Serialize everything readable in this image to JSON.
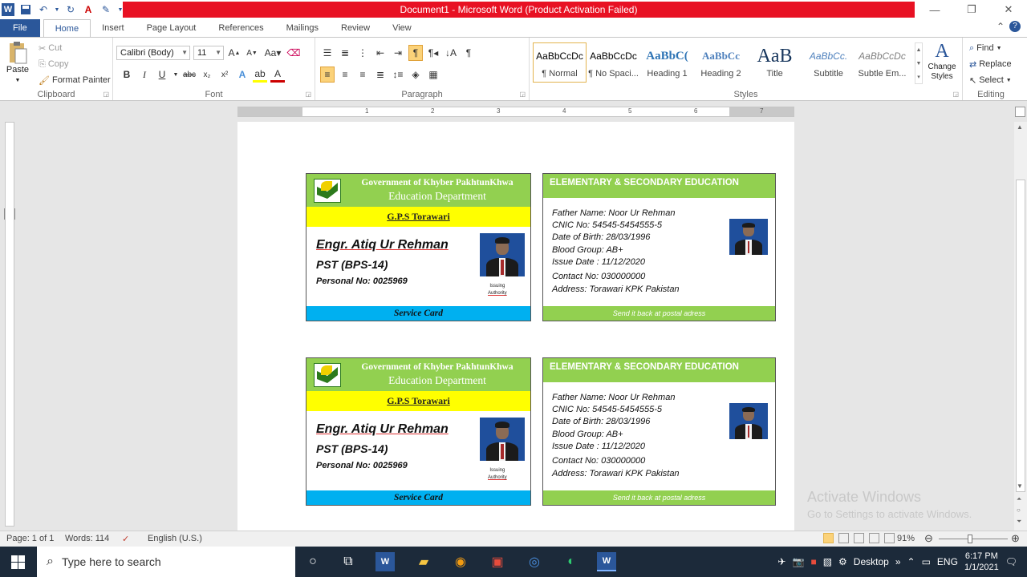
{
  "window": {
    "title": "Document1  -  Microsoft Word (Product Activation Failed)"
  },
  "tabs": [
    "File",
    "Home",
    "Insert",
    "Page Layout",
    "References",
    "Mailings",
    "Review",
    "View"
  ],
  "clipboard": {
    "paste": "Paste",
    "cut": "Cut",
    "copy": "Copy",
    "format_painter": "Format Painter",
    "label": "Clipboard"
  },
  "font": {
    "family": "Calibri (Body)",
    "size": "11",
    "label": "Font"
  },
  "paragraph": {
    "label": "Paragraph"
  },
  "styles": {
    "label": "Styles",
    "items": [
      {
        "preview": "AaBbCcDc",
        "name": "¶ Normal",
        "color": "#000000"
      },
      {
        "preview": "AaBbCcDc",
        "name": "¶ No Spaci...",
        "color": "#000000"
      },
      {
        "preview": "AaBbC(",
        "name": "Heading 1",
        "color": "#2e74b5"
      },
      {
        "preview": "AaBbCc",
        "name": "Heading 2",
        "color": "#4f81bd"
      },
      {
        "preview": "AaB",
        "name": "Title",
        "color": "#17365d"
      },
      {
        "preview": "AaBbCc.",
        "name": "Subtitle",
        "color": "#4f81bd"
      },
      {
        "preview": "AaBbCcDc",
        "name": "Subtle Em...",
        "color": "#808080"
      }
    ],
    "change_styles": "Change Styles"
  },
  "editing": {
    "find": "Find",
    "replace": "Replace",
    "select": "Select",
    "label": "Editing"
  },
  "ruler": {
    "numbers": [
      "1",
      "2",
      "3",
      "4",
      "5",
      "6",
      "7"
    ]
  },
  "cards": {
    "front": {
      "gov": "Government of Khyber PakhtunKhwa",
      "dept": "Education Department",
      "school": "G.P.S Torawari",
      "name": "Engr. Atiq Ur Rehman",
      "post": "PST (BPS-14)",
      "personal_no": "Personal No: 0025969",
      "issuing_1": "Issuing",
      "issuing_2": "Authority",
      "band": "Service Card"
    },
    "back": {
      "title": "ELEMENTARY & SECONDARY EDUCATION",
      "father": "Father Name:  Noor Ur Rehman",
      "cnic": "CNIC No: 54545-5454555-5",
      "dob": "Date of Birth: 28/03/1996",
      "blood": "Blood Group: AB+",
      "issue": "Issue Date : 11/12/2020",
      "contact": "Contact No: 030000000",
      "address": "Address: Torawari KPK Pakistan",
      "band": "Send it back at postal adress"
    }
  },
  "watermark": {
    "line1": "Activate Windows",
    "line2": "Go to Settings to activate Windows."
  },
  "status": {
    "page": "Page: 1 of 1",
    "words": "Words: 114",
    "language": "English (U.S.)",
    "zoom": "91%"
  },
  "taskbar": {
    "search_placeholder": "Type here to search",
    "desktop": "Desktop",
    "lang": "ENG",
    "time": "6:17 PM",
    "date": "1/1/2021"
  },
  "colors": {
    "accent": "#2b579a",
    "title_bar_error": "#e81123",
    "card_green": "#92d050",
    "card_yellow": "#ffff00",
    "card_blue": "#00b0f0"
  }
}
